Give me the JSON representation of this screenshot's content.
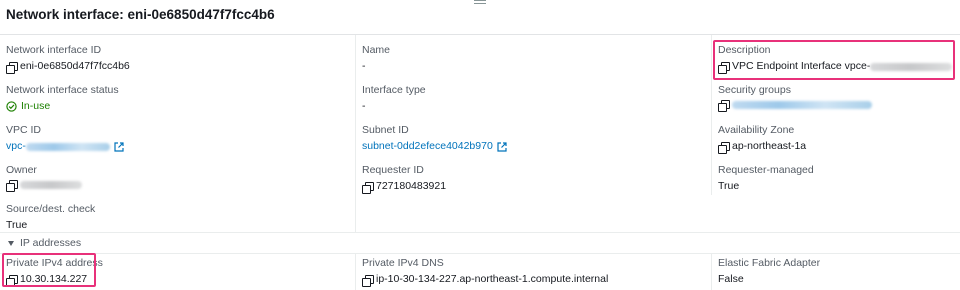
{
  "page": {
    "title": "Network interface: eni-0e6850d47f7fcc4b6"
  },
  "details": {
    "network_interface_id": {
      "label": "Network interface ID",
      "value": "eni-0e6850d47f7fcc4b6"
    },
    "name": {
      "label": "Name",
      "value": "-"
    },
    "description": {
      "label": "Description",
      "value": "VPC Endpoint Interface vpce-"
    },
    "network_interface_status": {
      "label": "Network interface status",
      "value": "In-use"
    },
    "interface_type": {
      "label": "Interface type",
      "value": "-"
    },
    "security_groups": {
      "label": "Security groups"
    },
    "vpc_id": {
      "label": "VPC ID",
      "value": "vpc-"
    },
    "subnet_id": {
      "label": "Subnet ID",
      "value": "subnet-0dd2efece4042b970"
    },
    "availability_zone": {
      "label": "Availability Zone",
      "value": "ap-northeast-1a"
    },
    "owner": {
      "label": "Owner"
    },
    "requester_id": {
      "label": "Requester ID",
      "value": "727180483921"
    },
    "requester_managed": {
      "label": "Requester-managed",
      "value": "True"
    },
    "source_dest_check": {
      "label": "Source/dest. check",
      "value": "True"
    }
  },
  "ip_addresses": {
    "section_label": "IP addresses",
    "private_ipv4_address": {
      "label": "Private IPv4 address",
      "value": "10.30.134.227"
    },
    "private_ipv4_dns": {
      "label": "Private IPv4 DNS",
      "value": "ip-10-30-134-227.ap-northeast-1.compute.internal"
    },
    "elastic_fabric_adapter": {
      "label": "Elastic Fabric Adapter",
      "value": "False"
    }
  },
  "colors": {
    "link": "#0073bb",
    "status_green": "#1d8102",
    "highlight": "#e8317a"
  },
  "icons": [
    "copy-icon",
    "external-link-icon",
    "check-circle-icon",
    "caret-down-icon"
  ]
}
